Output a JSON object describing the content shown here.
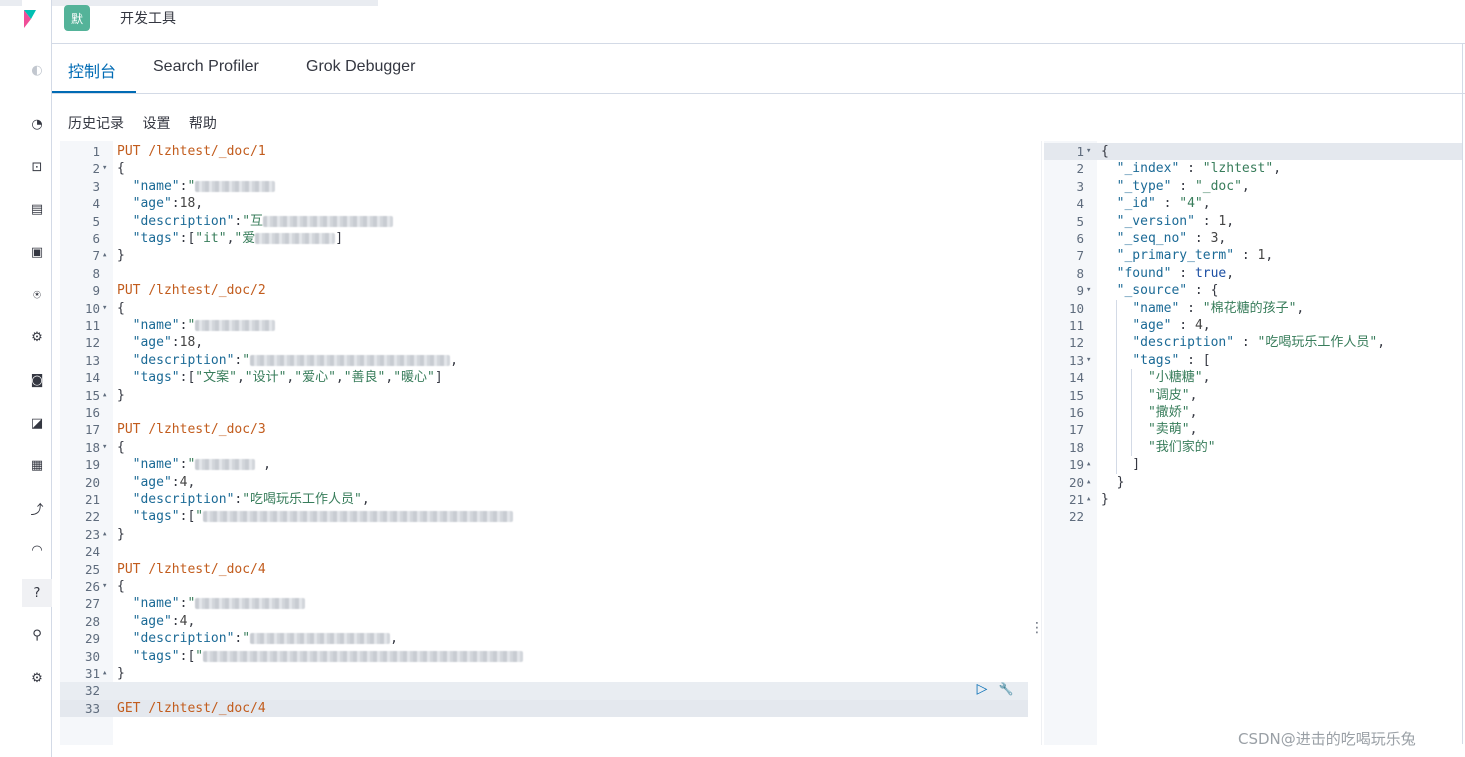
{
  "header": {
    "avatar_letter": "默",
    "breadcrumb": "开发工具"
  },
  "tabs": [
    {
      "label": "控制台",
      "active": true
    },
    {
      "label": "Search Profiler",
      "active": false
    },
    {
      "label": "Grok Debugger",
      "active": false
    }
  ],
  "menu": {
    "history": "历史记录",
    "settings": "设置",
    "help": "帮助"
  },
  "request": {
    "lines": [
      {
        "n": "1",
        "fold": "",
        "code": [
          [
            "kw",
            "PUT "
          ],
          [
            "kw",
            "/lzhtest/_doc/1"
          ]
        ]
      },
      {
        "n": "2",
        "fold": "▾",
        "code": [
          [
            "p",
            "{"
          ]
        ]
      },
      {
        "n": "3",
        "fold": "",
        "code": [
          [
            "p",
            "  "
          ],
          [
            "key",
            "\"name\""
          ],
          [
            "p",
            ":"
          ],
          [
            "str",
            "\""
          ],
          [
            "blur",
            "80"
          ]
        ]
      },
      {
        "n": "4",
        "fold": "",
        "code": [
          [
            "p",
            "  "
          ],
          [
            "key",
            "\"age\""
          ],
          [
            "p",
            ":"
          ],
          [
            "num",
            "18"
          ],
          [
            "p",
            ","
          ]
        ]
      },
      {
        "n": "5",
        "fold": "",
        "code": [
          [
            "p",
            "  "
          ],
          [
            "key",
            "\"description\""
          ],
          [
            "p",
            ":"
          ],
          [
            "str",
            "\"互"
          ],
          [
            "blur",
            "130"
          ]
        ]
      },
      {
        "n": "6",
        "fold": "",
        "code": [
          [
            "p",
            "  "
          ],
          [
            "key",
            "\"tags\""
          ],
          [
            "p",
            ":["
          ],
          [
            "str",
            "\"it\""
          ],
          [
            "p",
            ","
          ],
          [
            "str",
            "\"爱"
          ],
          [
            "blur",
            "80"
          ],
          [
            "p",
            "]"
          ]
        ]
      },
      {
        "n": "7",
        "fold": "▴",
        "code": [
          [
            "p",
            "}"
          ]
        ]
      },
      {
        "n": "8",
        "fold": "",
        "code": []
      },
      {
        "n": "9",
        "fold": "",
        "code": [
          [
            "kw",
            "PUT "
          ],
          [
            "kw",
            "/lzhtest/_doc/2"
          ]
        ]
      },
      {
        "n": "10",
        "fold": "▾",
        "code": [
          [
            "p",
            "{"
          ]
        ]
      },
      {
        "n": "11",
        "fold": "",
        "code": [
          [
            "p",
            "  "
          ],
          [
            "key",
            "\"name\""
          ],
          [
            "p",
            ":"
          ],
          [
            "str",
            "\""
          ],
          [
            "blur",
            "80"
          ]
        ]
      },
      {
        "n": "12",
        "fold": "",
        "code": [
          [
            "p",
            "  "
          ],
          [
            "key",
            "\"age\""
          ],
          [
            "p",
            ":"
          ],
          [
            "num",
            "18"
          ],
          [
            "p",
            ","
          ]
        ]
      },
      {
        "n": "13",
        "fold": "",
        "code": [
          [
            "p",
            "  "
          ],
          [
            "key",
            "\"description\""
          ],
          [
            "p",
            ":"
          ],
          [
            "str",
            "\""
          ],
          [
            "blur",
            "200"
          ],
          [
            "p",
            ","
          ]
        ]
      },
      {
        "n": "14",
        "fold": "",
        "code": [
          [
            "p",
            "  "
          ],
          [
            "key",
            "\"tags\""
          ],
          [
            "p",
            ":["
          ],
          [
            "str",
            "\"文案\""
          ],
          [
            "p",
            ","
          ],
          [
            "str",
            "\"设计\""
          ],
          [
            "p",
            ","
          ],
          [
            "str",
            "\"爱心\""
          ],
          [
            "p",
            ","
          ],
          [
            "str",
            "\"善良\""
          ],
          [
            "p",
            ","
          ],
          [
            "str",
            "\"暖心\""
          ],
          [
            "p",
            "]"
          ]
        ]
      },
      {
        "n": "15",
        "fold": "▴",
        "code": [
          [
            "p",
            "}"
          ]
        ]
      },
      {
        "n": "16",
        "fold": "",
        "code": []
      },
      {
        "n": "17",
        "fold": "",
        "code": [
          [
            "kw",
            "PUT "
          ],
          [
            "kw",
            "/lzhtest/_doc/3"
          ]
        ]
      },
      {
        "n": "18",
        "fold": "▾",
        "code": [
          [
            "p",
            "{"
          ]
        ]
      },
      {
        "n": "19",
        "fold": "",
        "code": [
          [
            "p",
            "  "
          ],
          [
            "key",
            "\"name\""
          ],
          [
            "p",
            ":"
          ],
          [
            "str",
            "\""
          ],
          [
            "blur",
            "60"
          ],
          [
            "p",
            " ,"
          ]
        ]
      },
      {
        "n": "20",
        "fold": "",
        "code": [
          [
            "p",
            "  "
          ],
          [
            "key",
            "\"age\""
          ],
          [
            "p",
            ":"
          ],
          [
            "num",
            "4"
          ],
          [
            "p",
            ","
          ]
        ]
      },
      {
        "n": "21",
        "fold": "",
        "code": [
          [
            "p",
            "  "
          ],
          [
            "key",
            "\"description\""
          ],
          [
            "p",
            ":"
          ],
          [
            "str",
            "\"吃喝玩乐工作人员\""
          ],
          [
            "p",
            ","
          ]
        ]
      },
      {
        "n": "22",
        "fold": "",
        "code": [
          [
            "p",
            "  "
          ],
          [
            "key",
            "\"tags\""
          ],
          [
            "p",
            ":["
          ],
          [
            "str",
            "\""
          ],
          [
            "blur",
            "310"
          ]
        ]
      },
      {
        "n": "23",
        "fold": "▴",
        "code": [
          [
            "p",
            "}"
          ]
        ]
      },
      {
        "n": "24",
        "fold": "",
        "code": []
      },
      {
        "n": "25",
        "fold": "",
        "code": [
          [
            "kw",
            "PUT "
          ],
          [
            "kw",
            "/lzhtest/_doc/4"
          ]
        ]
      },
      {
        "n": "26",
        "fold": "▾",
        "code": [
          [
            "p",
            "{"
          ]
        ]
      },
      {
        "n": "27",
        "fold": "",
        "code": [
          [
            "p",
            "  "
          ],
          [
            "key",
            "\"name\""
          ],
          [
            "p",
            ":"
          ],
          [
            "str",
            "\""
          ],
          [
            "blur",
            "110"
          ]
        ]
      },
      {
        "n": "28",
        "fold": "",
        "code": [
          [
            "p",
            "  "
          ],
          [
            "key",
            "\"age\""
          ],
          [
            "p",
            ":"
          ],
          [
            "num",
            "4"
          ],
          [
            "p",
            ","
          ]
        ]
      },
      {
        "n": "29",
        "fold": "",
        "code": [
          [
            "p",
            "  "
          ],
          [
            "key",
            "\"description\""
          ],
          [
            "p",
            ":"
          ],
          [
            "str",
            "\""
          ],
          [
            "blur",
            "140"
          ],
          [
            "p",
            ","
          ]
        ]
      },
      {
        "n": "30",
        "fold": "",
        "code": [
          [
            "p",
            "  "
          ],
          [
            "key",
            "\"tags\""
          ],
          [
            "p",
            ":["
          ],
          [
            "str",
            "\""
          ],
          [
            "blur",
            "320"
          ]
        ]
      },
      {
        "n": "31",
        "fold": "▴",
        "code": [
          [
            "p",
            "}"
          ]
        ]
      },
      {
        "n": "32",
        "fold": "",
        "code": []
      },
      {
        "n": "33",
        "fold": "",
        "code": [
          [
            "kw",
            "GET "
          ],
          [
            "kw",
            "/lzhtest/_doc/4"
          ]
        ]
      }
    ]
  },
  "response": {
    "lines": [
      {
        "n": "1",
        "fold": "▾",
        "code": [
          [
            "p",
            "{"
          ]
        ]
      },
      {
        "n": "2",
        "fold": "",
        "code": [
          [
            "p",
            "  "
          ],
          [
            "key",
            "\"_index\""
          ],
          [
            "p",
            " : "
          ],
          [
            "str",
            "\"lzhtest\""
          ],
          [
            "p",
            ","
          ]
        ]
      },
      {
        "n": "3",
        "fold": "",
        "code": [
          [
            "p",
            "  "
          ],
          [
            "key",
            "\"_type\""
          ],
          [
            "p",
            " : "
          ],
          [
            "str",
            "\"_doc\""
          ],
          [
            "p",
            ","
          ]
        ]
      },
      {
        "n": "4",
        "fold": "",
        "code": [
          [
            "p",
            "  "
          ],
          [
            "key",
            "\"_id\""
          ],
          [
            "p",
            " : "
          ],
          [
            "str",
            "\"4\""
          ],
          [
            "p",
            ","
          ]
        ]
      },
      {
        "n": "5",
        "fold": "",
        "code": [
          [
            "p",
            "  "
          ],
          [
            "key",
            "\"_version\""
          ],
          [
            "p",
            " : "
          ],
          [
            "num",
            "1"
          ],
          [
            "p",
            ","
          ]
        ]
      },
      {
        "n": "6",
        "fold": "",
        "code": [
          [
            "p",
            "  "
          ],
          [
            "key",
            "\"_seq_no\""
          ],
          [
            "p",
            " : "
          ],
          [
            "num",
            "3"
          ],
          [
            "p",
            ","
          ]
        ]
      },
      {
        "n": "7",
        "fold": "",
        "code": [
          [
            "p",
            "  "
          ],
          [
            "key",
            "\"_primary_term\""
          ],
          [
            "p",
            " : "
          ],
          [
            "num",
            "1"
          ],
          [
            "p",
            ","
          ]
        ]
      },
      {
        "n": "8",
        "fold": "",
        "code": [
          [
            "p",
            "  "
          ],
          [
            "key",
            "\"found\""
          ],
          [
            "p",
            " : "
          ],
          [
            "bool",
            "true"
          ],
          [
            "p",
            ","
          ]
        ]
      },
      {
        "n": "9",
        "fold": "▾",
        "code": [
          [
            "p",
            "  "
          ],
          [
            "key",
            "\"_source\""
          ],
          [
            "p",
            " : {"
          ]
        ]
      },
      {
        "n": "10",
        "fold": "",
        "code": [
          [
            "p",
            "    "
          ],
          [
            "key",
            "\"name\""
          ],
          [
            "p",
            " : "
          ],
          [
            "str",
            "\"棉花糖的孩子\""
          ],
          [
            "p",
            ","
          ]
        ]
      },
      {
        "n": "11",
        "fold": "",
        "code": [
          [
            "p",
            "    "
          ],
          [
            "key",
            "\"age\""
          ],
          [
            "p",
            " : "
          ],
          [
            "num",
            "4"
          ],
          [
            "p",
            ","
          ]
        ]
      },
      {
        "n": "12",
        "fold": "",
        "code": [
          [
            "p",
            "    "
          ],
          [
            "key",
            "\"description\""
          ],
          [
            "p",
            " : "
          ],
          [
            "str",
            "\"吃喝玩乐工作人员\""
          ],
          [
            "p",
            ","
          ]
        ]
      },
      {
        "n": "13",
        "fold": "▾",
        "code": [
          [
            "p",
            "    "
          ],
          [
            "key",
            "\"tags\""
          ],
          [
            "p",
            " : ["
          ]
        ]
      },
      {
        "n": "14",
        "fold": "",
        "code": [
          [
            "p",
            "      "
          ],
          [
            "str",
            "\"小糖糖\""
          ],
          [
            "p",
            ","
          ]
        ]
      },
      {
        "n": "15",
        "fold": "",
        "code": [
          [
            "p",
            "      "
          ],
          [
            "str",
            "\"调皮\""
          ],
          [
            "p",
            ","
          ]
        ]
      },
      {
        "n": "16",
        "fold": "",
        "code": [
          [
            "p",
            "      "
          ],
          [
            "str",
            "\"撒娇\""
          ],
          [
            "p",
            ","
          ]
        ]
      },
      {
        "n": "17",
        "fold": "",
        "code": [
          [
            "p",
            "      "
          ],
          [
            "str",
            "\"卖萌\""
          ],
          [
            "p",
            ","
          ]
        ]
      },
      {
        "n": "18",
        "fold": "",
        "code": [
          [
            "p",
            "      "
          ],
          [
            "str",
            "\"我们家的\""
          ]
        ]
      },
      {
        "n": "19",
        "fold": "▴",
        "code": [
          [
            "p",
            "    ]"
          ]
        ]
      },
      {
        "n": "20",
        "fold": "▴",
        "code": [
          [
            "p",
            "  }"
          ]
        ]
      },
      {
        "n": "21",
        "fold": "▴",
        "code": [
          [
            "p",
            "}"
          ]
        ]
      },
      {
        "n": "22",
        "fold": "",
        "code": []
      }
    ]
  },
  "icons": {
    "run": "▷",
    "wrench": "🔧",
    "resize": "⋮"
  },
  "watermark": "CSDN@进击的吃喝玩乐兔"
}
